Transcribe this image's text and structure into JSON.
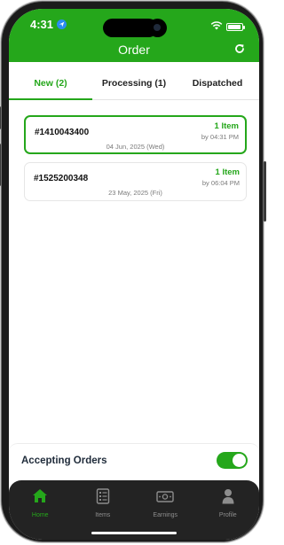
{
  "status_bar": {
    "time": "4:31"
  },
  "header": {
    "title": "Order"
  },
  "tabs": [
    {
      "label": "New (2)",
      "active": true
    },
    {
      "label": "Processing (1)",
      "active": false
    },
    {
      "label": "Dispatched",
      "active": false
    }
  ],
  "orders": [
    {
      "id": "#1410043400",
      "items": "1 Item",
      "by": "by 04:31 PM",
      "date": "04 Jun, 2025 (Wed)",
      "selected": true
    },
    {
      "id": "#1525200348",
      "items": "1 Item",
      "by": "by 06:04 PM",
      "date": "23 May, 2025 (Fri)",
      "selected": false
    }
  ],
  "accepting": {
    "label": "Accepting Orders",
    "enabled": true
  },
  "nav": [
    {
      "label": "Home",
      "icon": "home-icon",
      "active": true
    },
    {
      "label": "Items",
      "icon": "items-icon",
      "active": false
    },
    {
      "label": "Earnings",
      "icon": "earnings-icon",
      "active": false
    },
    {
      "label": "Profile",
      "icon": "profile-icon",
      "active": false
    }
  ],
  "colors": {
    "accent": "#25a71b",
    "nav_bg": "#232323"
  }
}
